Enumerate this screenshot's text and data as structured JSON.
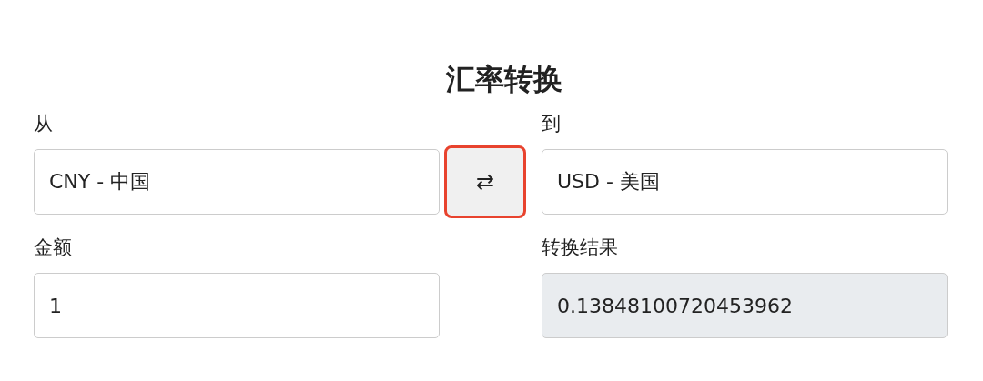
{
  "title": "汇率转换",
  "from": {
    "label": "从",
    "value": "CNY - 中国"
  },
  "swap_button": {
    "label": "⇄",
    "highlighted": true
  },
  "to": {
    "label": "到",
    "value": "USD - 美国"
  },
  "amount": {
    "label": "金额",
    "value": "1",
    "readonly": false
  },
  "result": {
    "label": "转换结果",
    "value": "0.13848100720453962",
    "readonly": true
  }
}
